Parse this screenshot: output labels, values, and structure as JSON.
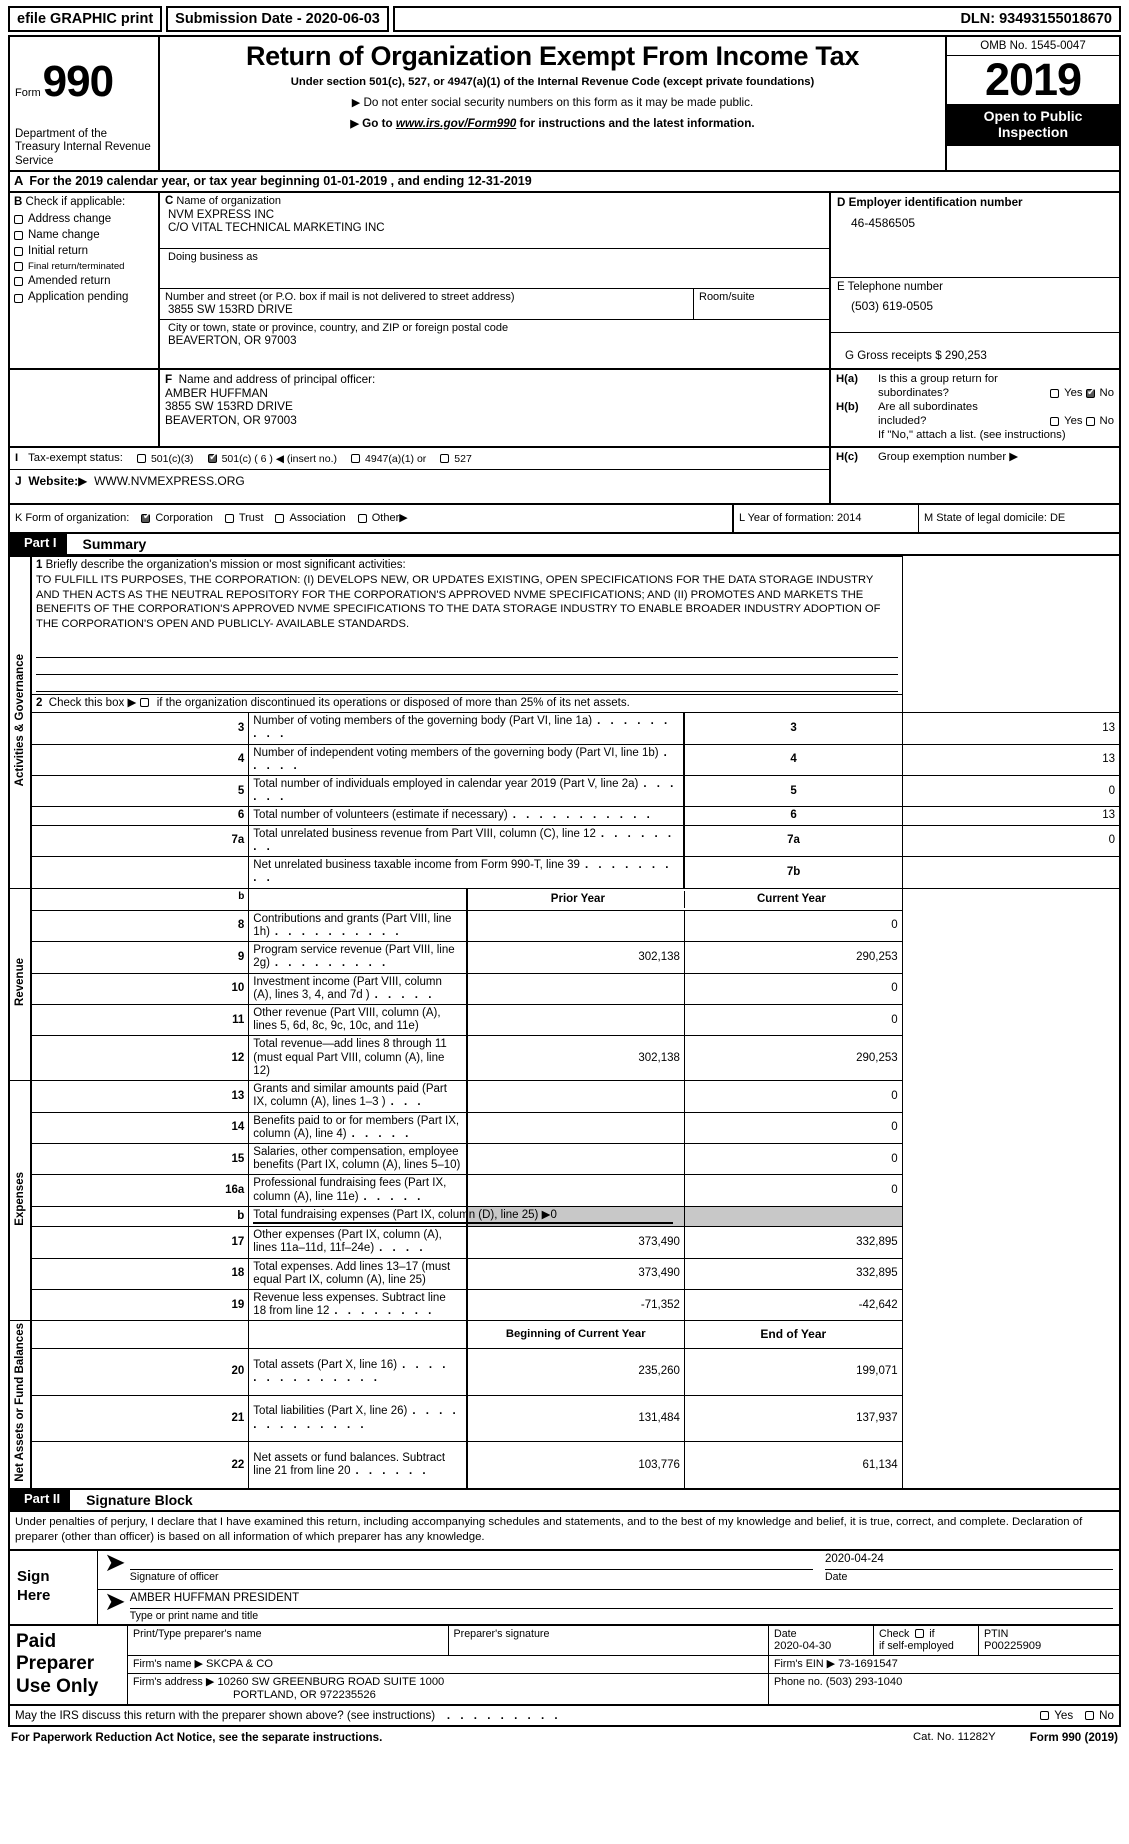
{
  "efile": {
    "print_label": "efile GRAPHIC print",
    "submission_date": "Submission Date - 2020-06-03",
    "dln": "DLN: 93493155018670"
  },
  "header": {
    "form_label": "Form",
    "form_number": "990",
    "department": "Department of the Treasury Internal Revenue Service",
    "title": "Return of Organization Exempt From Income Tax",
    "subtitle": "Under section 501(c), 527, or 4947(a)(1) of the Internal Revenue Code (except private foundations)",
    "note1": "Do not enter social security numbers on this form as it may be made public.",
    "note2_prefix": "Go to ",
    "note2_url": "www.irs.gov/Form990",
    "note2_suffix": " for instructions and the latest information.",
    "omb": "OMB No. 1545-0047",
    "tax_year": "2019",
    "open_to_public": "Open to Public Inspection"
  },
  "line_a": {
    "letter": "A",
    "text": "For the 2019 calendar year, or tax year beginning 01-01-2019   , and ending 12-31-2019"
  },
  "section_b": {
    "letter": "B",
    "title": "Check if applicable:",
    "options": [
      {
        "label": "Address change",
        "checked": false
      },
      {
        "label": "Name change",
        "checked": false
      },
      {
        "label": "Initial return",
        "checked": false
      },
      {
        "label": "Final return/terminated",
        "checked": false
      },
      {
        "label": "Amended return",
        "checked": false
      },
      {
        "label": "Application pending",
        "checked": false
      }
    ]
  },
  "section_c": {
    "letter": "C",
    "name_label": "Name of organization",
    "name_line1": "NVM EXPRESS INC",
    "name_line2": "C/O VITAL TECHNICAL MARKETING INC",
    "dba_label": "Doing business as",
    "dba_value": "",
    "street_label": "Number and street (or P.O. box if mail is not delivered to street address)",
    "street_value": "3855 SW 153RD DRIVE",
    "room_label": "Room/suite",
    "room_value": "",
    "city_label": "City or town, state or province, country, and ZIP or foreign postal code",
    "city_value": "BEAVERTON, OR  97003"
  },
  "section_d": {
    "label": "D Employer identification number",
    "value": "46-4586505"
  },
  "section_e": {
    "label": "E Telephone number",
    "value": "(503) 619-0505"
  },
  "section_g": {
    "label": "G Gross receipts $ 290,253"
  },
  "section_f": {
    "letter": "F",
    "label": "Name and address of principal officer:",
    "lines": [
      "AMBER HUFFMAN",
      "3855 SW 153RD DRIVE",
      "BEAVERTON, OR  97003"
    ]
  },
  "section_h": {
    "a_label": "H(a)",
    "a_text_1": "Is this a group return for",
    "a_text_2": "subordinates?",
    "a_yes": "Yes",
    "a_no": "No",
    "a_yes_checked": false,
    "a_no_checked": true,
    "b_label": "H(b)",
    "b_text_1": "Are all subordinates",
    "b_text_2": "included?",
    "b_yes": "Yes",
    "b_no": "No",
    "b_yes_checked": false,
    "b_no_checked": false,
    "b_note": "If \"No,\" attach a list. (see instructions)",
    "c_label": "H(c)",
    "c_text": "Group exemption number"
  },
  "section_i": {
    "letter": "I",
    "label": "Tax-exempt status:",
    "options": [
      {
        "label": "501(c)(3)",
        "checked": false
      },
      {
        "label": "501(c) ( 6 ) ◀ (insert no.)",
        "checked": true
      },
      {
        "label": "4947(a)(1) or",
        "checked": false
      },
      {
        "label": "527",
        "checked": false
      }
    ]
  },
  "section_j": {
    "letter": "J",
    "label": "Website:",
    "value": "WWW.NVMEXPRESS.ORG"
  },
  "section_k": {
    "label": "K Form of organization:",
    "options": [
      {
        "label": "Corporation",
        "checked": true
      },
      {
        "label": "Trust",
        "checked": false
      },
      {
        "label": "Association",
        "checked": false
      },
      {
        "label": "Other",
        "checked": false
      }
    ]
  },
  "section_l": {
    "label": "L Year of formation: 2014"
  },
  "section_m": {
    "label": "M State of legal domicile: DE"
  },
  "part1": {
    "tag": "Part I",
    "title": "Summary",
    "side_label": "Activities & Governance",
    "revenue_label": "Revenue",
    "expenses_label": "Expenses",
    "netassets_label": "Net Assets or Fund Balances",
    "mission_num": "1",
    "mission_label": "Briefly describe the organization's mission or most significant activities:",
    "mission_text": "TO FULFILL ITS PURPOSES, THE CORPORATION: (I) DEVELOPS NEW, OR UPDATES EXISTING, OPEN SPECIFICATIONS FOR THE DATA STORAGE INDUSTRY AND THEN ACTS AS THE NEUTRAL REPOSITORY FOR THE CORPORATION'S APPROVED NVME SPECIFICATIONS; AND (II) PROMOTES AND MARKETS THE BENEFITS OF THE CORPORATION'S APPROVED NVME SPECIFICATIONS TO THE DATA STORAGE INDUSTRY TO ENABLE BROADER INDUSTRY ADOPTION OF THE CORPORATION'S OPEN AND PUBLICLY- AVAILABLE STANDARDS.",
    "line2_num": "2",
    "line2_text_a": "Check this box",
    "line2_text_b": "if the organization discontinued its operations or disposed of more than 25% of its net assets.",
    "gov_rows": [
      {
        "num": "3",
        "desc": "Number of voting members of the governing body (Part VI, line 1a)",
        "ref": "3",
        "value": "13",
        "dots": 9
      },
      {
        "num": "4",
        "desc": "Number of independent voting members of the governing body (Part VI, line 1b)",
        "ref": "4",
        "value": "13",
        "dots": 5
      },
      {
        "num": "5",
        "desc": "Total number of individuals employed in calendar year 2019 (Part V, line 2a)",
        "ref": "5",
        "value": "0",
        "dots": 6
      },
      {
        "num": "6",
        "desc": "Total number of volunteers (estimate if necessary)",
        "ref": "6",
        "value": "13",
        "dots": 11
      },
      {
        "num": "7a",
        "desc": "Total unrelated business revenue from Part VIII, column (C), line 12",
        "ref": "7a",
        "value": "0",
        "dots": 8
      },
      {
        "num": "",
        "desc": "Net unrelated business taxable income from Form 990-T, line 39",
        "ref": "7b",
        "value": "",
        "dots": 9
      }
    ],
    "b_marker": "b",
    "col_prior": "Prior Year",
    "col_current": "Current Year",
    "revenue_rows": [
      {
        "num": "8",
        "desc": "Contributions and grants (Part VIII, line 1h)",
        "prior": "",
        "current": "0",
        "dots": 10
      },
      {
        "num": "9",
        "desc": "Program service revenue (Part VIII, line 2g)",
        "prior": "302,138",
        "current": "290,253",
        "dots": 10
      },
      {
        "num": "10",
        "desc": "Investment income (Part VIII, column (A), lines 3, 4, and 7d )",
        "prior": "",
        "current": "0",
        "dots": 5
      },
      {
        "num": "11",
        "desc": "Other revenue (Part VIII, column (A), lines 5, 6d, 8c, 9c, 10c, and 11e)",
        "prior": "",
        "current": "0",
        "dots": 0
      },
      {
        "num": "12",
        "desc": "Total revenue—add lines 8 through 11 (must equal Part VIII, column (A), line 12)",
        "prior": "302,138",
        "current": "290,253",
        "dots": 0
      }
    ],
    "expense_rows": [
      {
        "num": "13",
        "desc": "Grants and similar amounts paid (Part IX, column (A), lines 1–3 )",
        "prior": "",
        "current": "0",
        "dots": 3
      },
      {
        "num": "14",
        "desc": "Benefits paid to or for members (Part IX, column (A), line 4)",
        "prior": "",
        "current": "0",
        "dots": 5
      },
      {
        "num": "15",
        "desc": "Salaries, other compensation, employee benefits (Part IX, column (A), lines 5–10)",
        "prior": "",
        "current": "0",
        "dots": 0
      },
      {
        "num": "16a",
        "desc": "Professional fundraising fees (Part IX, column (A), line 11e)",
        "prior": "",
        "current": "0",
        "dots": 5
      }
    ],
    "line16b": {
      "marker": "b",
      "desc": "Total fundraising expenses (Part IX, column (D), line 25)",
      "arrow_value": "0"
    },
    "expense_rows2": [
      {
        "num": "17",
        "desc": "Other expenses (Part IX, column (A), lines 11a–11d, 11f–24e)",
        "prior": "373,490",
        "current": "332,895",
        "dots": 4
      },
      {
        "num": "18",
        "desc": "Total expenses. Add lines 13–17 (must equal Part IX, column (A), line 25)",
        "prior": "373,490",
        "current": "332,895",
        "dots": 0
      },
      {
        "num": "19",
        "desc": "Revenue less expenses. Subtract line 18 from line 12",
        "prior": "-71,352",
        "current": "-42,642",
        "dots": 8
      }
    ],
    "col_begin": "Beginning of Current Year",
    "col_end": "End of Year",
    "asset_rows": [
      {
        "num": "20",
        "desc": "Total assets (Part X, line 16)",
        "prior": "235,260",
        "current": "199,071",
        "dots": 14
      },
      {
        "num": "21",
        "desc": "Total liabilities (Part X, line 26)",
        "prior": "131,484",
        "current": "137,937",
        "dots": 13
      },
      {
        "num": "22",
        "desc": "Net assets or fund balances. Subtract line 21 from line 20",
        "prior": "103,776",
        "current": "61,134",
        "dots": 6
      }
    ]
  },
  "part2": {
    "tag": "Part II",
    "title": "Signature Block",
    "perjury": "Under penalties of perjury, I declare that I have examined this return, including accompanying schedules and statements, and to the best of my knowledge and belief, it is true, correct, and complete. Declaration of preparer (other than officer) is based on all information of which preparer has any knowledge.",
    "sign_here": "Sign Here",
    "officer_sig_caption": "Signature of officer",
    "officer_sig_value": "",
    "date_caption": "Date",
    "date_value": "2020-04-24",
    "typed_name_caption": "Type or print name and title",
    "typed_name_value": "AMBER HUFFMAN  PRESIDENT"
  },
  "preparer": {
    "tag": "Paid Preparer Use Only",
    "col_name": "Print/Type preparer's name",
    "col_sig": "Preparer's signature",
    "col_date": "Date",
    "col_check": "Check",
    "col_check_sub": "if self-employed",
    "col_ptin": "PTIN",
    "name_value": "",
    "sig_value": "",
    "date_value": "2020-04-30",
    "check_checked": false,
    "ptin_value": "P00225909",
    "firm_name_label": "Firm's name",
    "firm_name_value": "SKCPA & CO",
    "firm_ein_label": "Firm's EIN",
    "firm_ein_value": "73-1691547",
    "firm_address_label": "Firm's address",
    "firm_address_value": "10260 SW GREENBURG ROAD SUITE 1000",
    "firm_address_value2": "PORTLAND, OR  972235526",
    "phone_label": "Phone no.",
    "phone_value": "(503) 293-1040"
  },
  "footer": {
    "discuss_text": "May the IRS discuss this return with the preparer shown above? (see instructions)",
    "discuss_yes": "Yes",
    "discuss_no": "No",
    "discuss_yes_checked": false,
    "discuss_no_checked": false,
    "paperwork": "For Paperwork Reduction Act Notice, see the separate instructions.",
    "cat": "Cat. No. 11282Y",
    "form_ref": "Form 990 (2019)"
  }
}
